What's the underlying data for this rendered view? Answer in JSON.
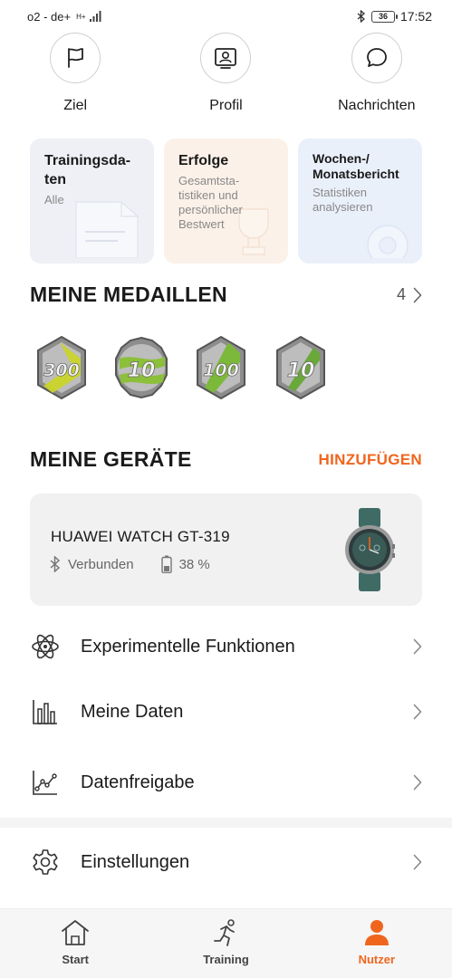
{
  "status_bar": {
    "carrier": "o2 - de+",
    "network_type": "H+",
    "battery": "36",
    "time": "17:52"
  },
  "top_actions": [
    {
      "label": "Ziel",
      "icon": "flag-icon"
    },
    {
      "label": "Profil",
      "icon": "profile-card-icon"
    },
    {
      "label": "Nachrichten",
      "icon": "chat-bubble-icon"
    }
  ],
  "cards": [
    {
      "title": "Trainingsda-\nten",
      "subtitle": "Alle"
    },
    {
      "title": "Erfolge",
      "subtitle": "Gesamtsta-\ntistiken und\npersönlicher\nBestwert"
    },
    {
      "title": "Wochen-/\nMonatsbericht",
      "subtitle": "Statistiken\nanalysieren"
    }
  ],
  "medals_section": {
    "title": "MEINE MEDAILLEN",
    "count": "4",
    "medals": [
      {
        "label": "300",
        "stripe_color": "#c9d42a"
      },
      {
        "label": "10",
        "stripe_color": "#8cbf3a"
      },
      {
        "label": "100",
        "stripe_color": "#7cb83a"
      },
      {
        "label": "10",
        "stripe_color": "#6aa83a"
      }
    ]
  },
  "devices_section": {
    "title": "MEINE GERÄTE",
    "add_label": "HINZUFÜGEN",
    "device": {
      "name": "HUAWEI WATCH GT-319",
      "connection": "Verbunden",
      "battery": "38 %"
    }
  },
  "menu": [
    {
      "label": "Experimentelle Funktionen",
      "icon": "atom-icon"
    },
    {
      "label": "Meine Daten",
      "icon": "bar-chart-icon"
    },
    {
      "label": "Datenfreigabe",
      "icon": "line-chart-icon"
    },
    {
      "label": "Einstellungen",
      "icon": "gear-icon"
    }
  ],
  "bottom_nav": [
    {
      "label": "Start",
      "icon": "home-icon",
      "active": false
    },
    {
      "label": "Training",
      "icon": "running-icon",
      "active": false
    },
    {
      "label": "Nutzer",
      "icon": "user-icon",
      "active": true
    }
  ],
  "colors": {
    "accent": "#f0651e",
    "text": "#1a1a1a",
    "muted": "#888888"
  }
}
